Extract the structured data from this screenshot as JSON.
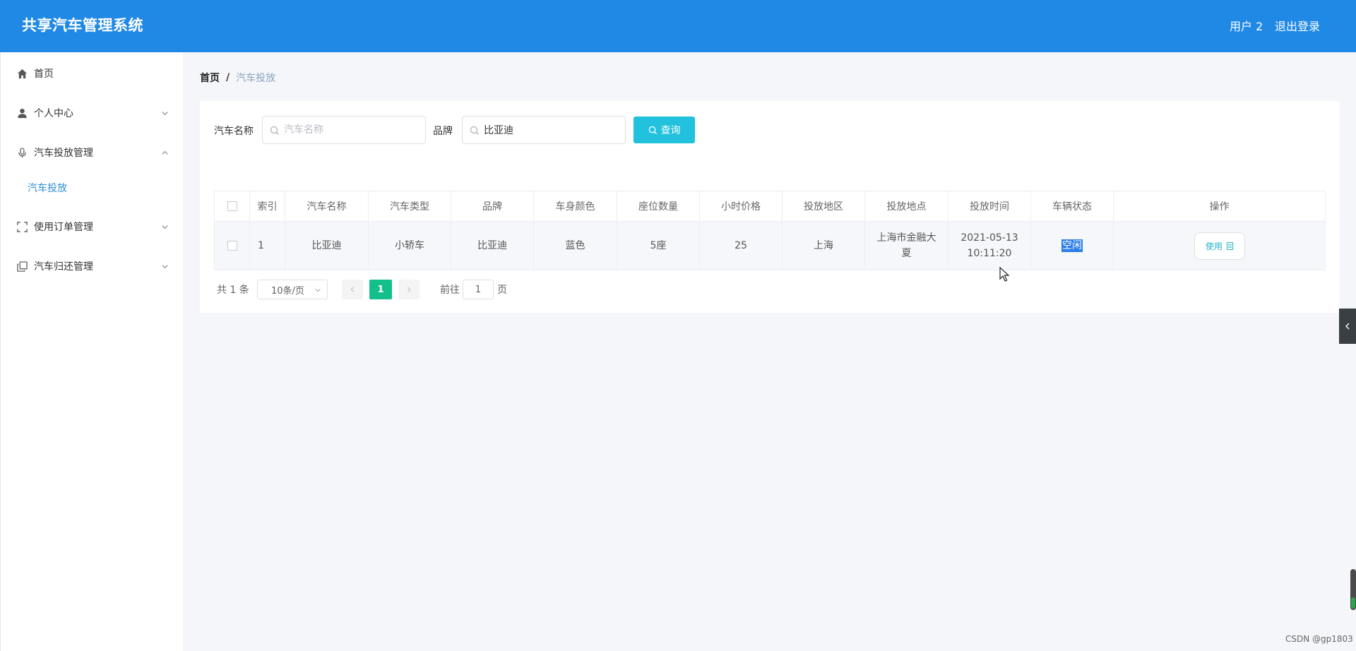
{
  "header": {
    "app_title": "共享汽车管理系统",
    "user_name": "用户 2",
    "logout_label": "退出登录",
    "bg_color": "#2089e6"
  },
  "sidebar": {
    "items": [
      {
        "label": "首页",
        "icon": "home-icon"
      },
      {
        "label": "个人中心",
        "icon": "user-icon",
        "expanded": false
      },
      {
        "label": "汽车投放管理",
        "icon": "microphone-icon",
        "expanded": true
      },
      {
        "label": "使用订单管理",
        "icon": "fullscreen-icon",
        "expanded": false
      },
      {
        "label": "汽车归还管理",
        "icon": "copy-icon",
        "expanded": false
      }
    ],
    "sub_items": [
      {
        "label": "汽车投放",
        "parent": "汽车投放管理",
        "active": true
      }
    ]
  },
  "breadcrumb": {
    "home": "首页",
    "separator": "/",
    "current": "汽车投放"
  },
  "search": {
    "car_name_label": "汽车名称",
    "car_name_placeholder": "汽车名称",
    "car_name_value": "",
    "brand_label": "品牌",
    "brand_value": "比亚迪",
    "query_label": "查询"
  },
  "table": {
    "columns": [
      "索引",
      "汽车名称",
      "汽车类型",
      "品牌",
      "车身颜色",
      "座位数量",
      "小时价格",
      "投放地区",
      "投放地点",
      "投放时间",
      "车辆状态",
      "操作"
    ],
    "rows": [
      {
        "index": "1",
        "car_name": "比亚迪",
        "car_type": "小轿车",
        "brand": "比亚迪",
        "color": "蓝色",
        "seats": "5座",
        "hourly_price": "25",
        "region": "上海",
        "location": "上海市金融大夏",
        "time": "2021-05-13 10:11:20",
        "status": "空闲",
        "action_label": "使用"
      }
    ]
  },
  "pagination": {
    "total": "共 1 条",
    "page_size": "10条/页",
    "current_page": "1",
    "goto_label": "前往",
    "goto_value": "1",
    "page_suffix": "页"
  },
  "watermark": "CSDN @gp1803",
  "colors": {
    "query_button": "#22c1dd",
    "active_page": "#13c08c",
    "active_menu": "#2f8fd8",
    "status_highlight": "#2b7de9"
  }
}
